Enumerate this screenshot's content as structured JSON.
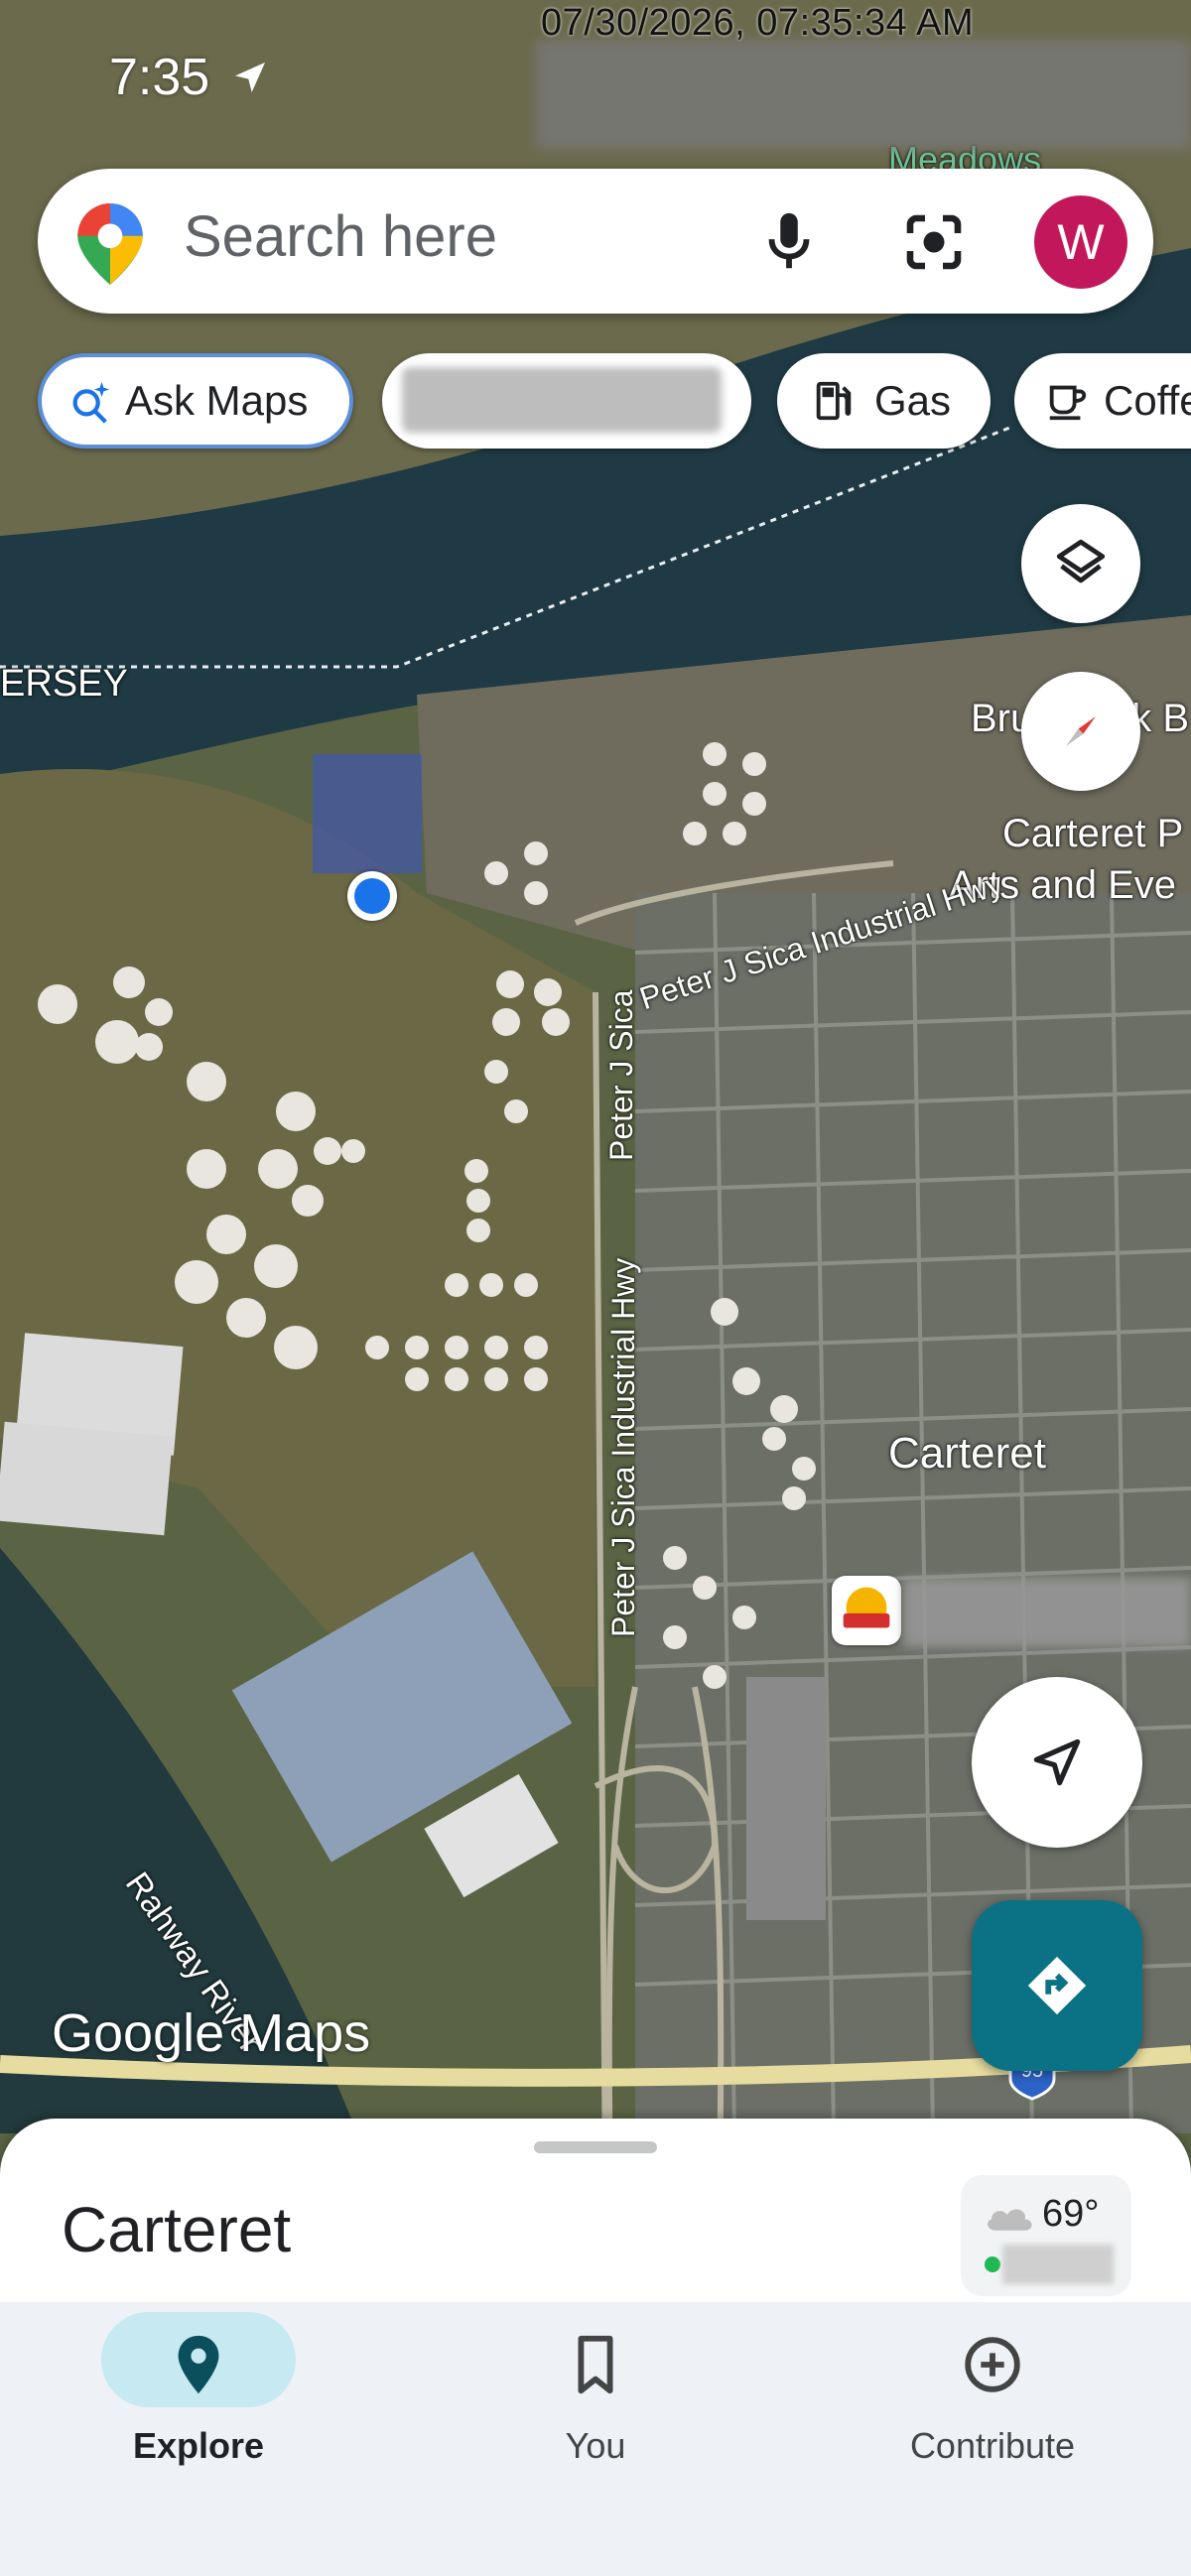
{
  "status_bar": {
    "time": "7:35",
    "timestamp": "07/30/2026, 07:35:34 AM"
  },
  "search": {
    "placeholder": "Search here",
    "avatar_letter": "W"
  },
  "chips": [
    {
      "label": "Ask Maps",
      "icon": "sparkle-search-icon"
    },
    {
      "label": "",
      "icon": ""
    },
    {
      "label": "Gas",
      "icon": "gas-pump-icon"
    },
    {
      "label": "Coffee",
      "icon": "coffee-cup-icon"
    }
  ],
  "map": {
    "labels": {
      "meadows": "Meadows",
      "jersey": "ERSEY",
      "brunswick": "Brunswick B",
      "carteret_pac_1": "Carteret P",
      "carteret_pac_2": "Arts and Eve",
      "industrial_hwy_top": "Peter J Sica Industrial Hwy",
      "peter_j_sica": "Peter J Sica",
      "industrial_hwy_vertical": "Peter J Sica Industrial Hwy",
      "carteret": "Carteret",
      "rahway_river": "Rahway River",
      "route_shield": "95"
    },
    "brand": "Google Maps"
  },
  "sheet": {
    "place_title": "Carteret",
    "weather_temp": "69°"
  },
  "bottom_nav": [
    {
      "label": "Explore",
      "icon": "location-pin-icon",
      "active": true
    },
    {
      "label": "You",
      "icon": "bookmark-icon",
      "active": false
    },
    {
      "label": "Contribute",
      "icon": "add-circle-icon",
      "active": false
    }
  ],
  "colors": {
    "accent": "#0b7285",
    "avatar": "#c2185b",
    "active_pill": "#c7e9f1"
  }
}
